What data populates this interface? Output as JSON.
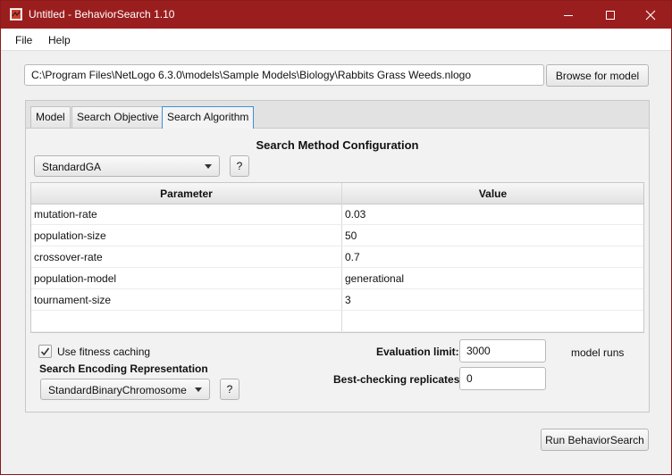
{
  "window": {
    "title": "Untitled - BehaviorSearch 1.10",
    "controls": {
      "minimize_icon": "minimize-icon",
      "maximize_icon": "maximize-icon",
      "close_icon": "close-icon"
    }
  },
  "menu": {
    "items": [
      "File",
      "Help"
    ]
  },
  "model": {
    "path": "C:\\Program Files\\NetLogo 6.3.0\\models\\Sample Models\\Biology\\Rabbits Grass Weeds.nlogo",
    "browse_label": "Browse for model"
  },
  "tabs": [
    "Model",
    "Search Objective",
    "Search Algorithm"
  ],
  "selected_tab": "Search Algorithm",
  "search_method": {
    "title": "Search Method Configuration",
    "selected": "StandardGA",
    "help_label": "?"
  },
  "parameters": {
    "headers": {
      "parameter": "Parameter",
      "value": "Value"
    },
    "rows": [
      {
        "name": "mutation-rate",
        "value": "0.03"
      },
      {
        "name": "population-size",
        "value": "50"
      },
      {
        "name": "crossover-rate",
        "value": "0.7"
      },
      {
        "name": "population-model",
        "value": "generational"
      },
      {
        "name": "tournament-size",
        "value": "3"
      }
    ]
  },
  "options": {
    "fitness_caching_label": "Use fitness caching",
    "fitness_caching_checked": true,
    "encoding_title": "Search Encoding Representation",
    "encoding_selected": "StandardBinaryChromosome",
    "encoding_help_label": "?",
    "evaluation_limit_label": "Evaluation limit:",
    "evaluation_limit_value": "3000",
    "model_runs_label": "model runs",
    "replicates_label": "Best-checking replicates:",
    "replicates_value": "0"
  },
  "run_label": "Run BehaviorSearch",
  "colors": {
    "titlebar": "#9b1e1e",
    "tab_focus": "#3d8fd8"
  }
}
